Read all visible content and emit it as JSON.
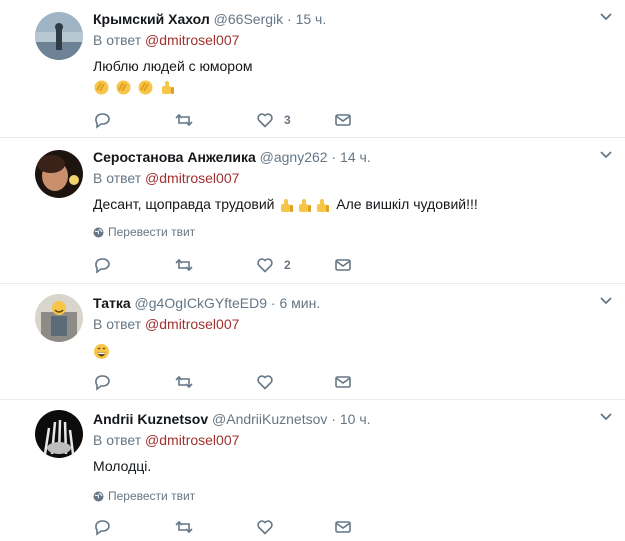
{
  "tweets": [
    {
      "fullname": "Крымский Хахол",
      "handle": "@66Sergik",
      "time": "15 ч.",
      "reply_prefix": "В ответ",
      "reply_mention": "@dmitrosel007",
      "text": "Люблю людей с юмором",
      "emojis": [
        "clapping-hands",
        "clapping-hands",
        "clapping-hands",
        "thumbs-up"
      ],
      "translate": "",
      "likes": "3"
    },
    {
      "fullname": "Серостанова Анжелика",
      "handle": "@agny262",
      "time": "14 ч.",
      "reply_prefix": "В ответ",
      "reply_mention": "@dmitrosel007",
      "text_before": "Десант, щоправда трудовий",
      "text_after": "Але вишкіл чудовий!!!",
      "emojis": [
        "thumbs-up",
        "thumbs-up",
        "thumbs-up"
      ],
      "translate": "Перевести твит",
      "likes": "2"
    },
    {
      "fullname": "Татка",
      "handle": "@g4OgICkGYfteED9",
      "time": "6 мин.",
      "reply_prefix": "В ответ",
      "reply_mention": "@dmitrosel007",
      "emojis": [
        "grinning-face"
      ],
      "translate": "",
      "likes": ""
    },
    {
      "fullname": "Andrii Kuznetsov",
      "handle": "@AndriiKuznetsov",
      "time": "10 ч.",
      "reply_prefix": "В ответ",
      "reply_mention": "@dmitrosel007",
      "text": "Молодці.",
      "translate": "Перевести твит",
      "likes": ""
    }
  ],
  "separator": "·",
  "colors": {
    "mention": "#a0312f",
    "secondary_text": "#657786",
    "divider": "#e6ecf0",
    "emoji_yellow": "#f7c548"
  },
  "icons": {
    "reply": "reply-icon",
    "retweet": "retweet-icon",
    "like": "heart-icon",
    "message": "envelope-icon",
    "caret": "chevron-down-icon",
    "globe": "globe-icon"
  }
}
